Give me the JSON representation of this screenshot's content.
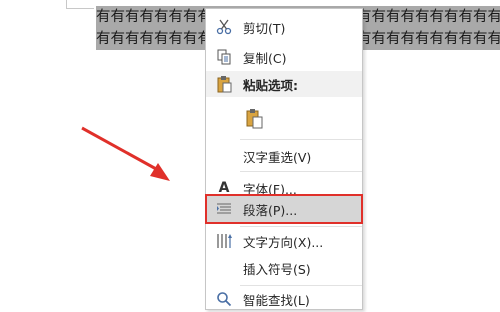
{
  "document": {
    "line1": "有有有有有有有有有有有有有有有有有有有有有有有有有有有有",
    "line2": "有有有有有有有有有有有有有有有有有有有有有有有有有有有有"
  },
  "context_menu": {
    "items": [
      {
        "label": "剪切(T)",
        "icon": "scissors-icon"
      },
      {
        "label": "复制(C)",
        "icon": "copy-icon"
      },
      {
        "label": "粘贴选项:",
        "icon": "clipboard-icon"
      },
      {
        "label": "",
        "icon": "paste-keep-text-icon"
      },
      {
        "label": "汉字重选(V)",
        "icon": ""
      },
      {
        "label": "字体(F)...",
        "icon": "font-icon"
      },
      {
        "label": "段落(P)...",
        "icon": "paragraph-icon"
      },
      {
        "label": "文字方向(X)...",
        "icon": "text-direction-icon"
      },
      {
        "label": "插入符号(S)",
        "icon": ""
      },
      {
        "label": "智能查找(L)",
        "icon": "smart-lookup-icon"
      }
    ]
  },
  "annotation": {
    "arrow_color": "#e0302a",
    "highlight_color": "#e0302a"
  }
}
